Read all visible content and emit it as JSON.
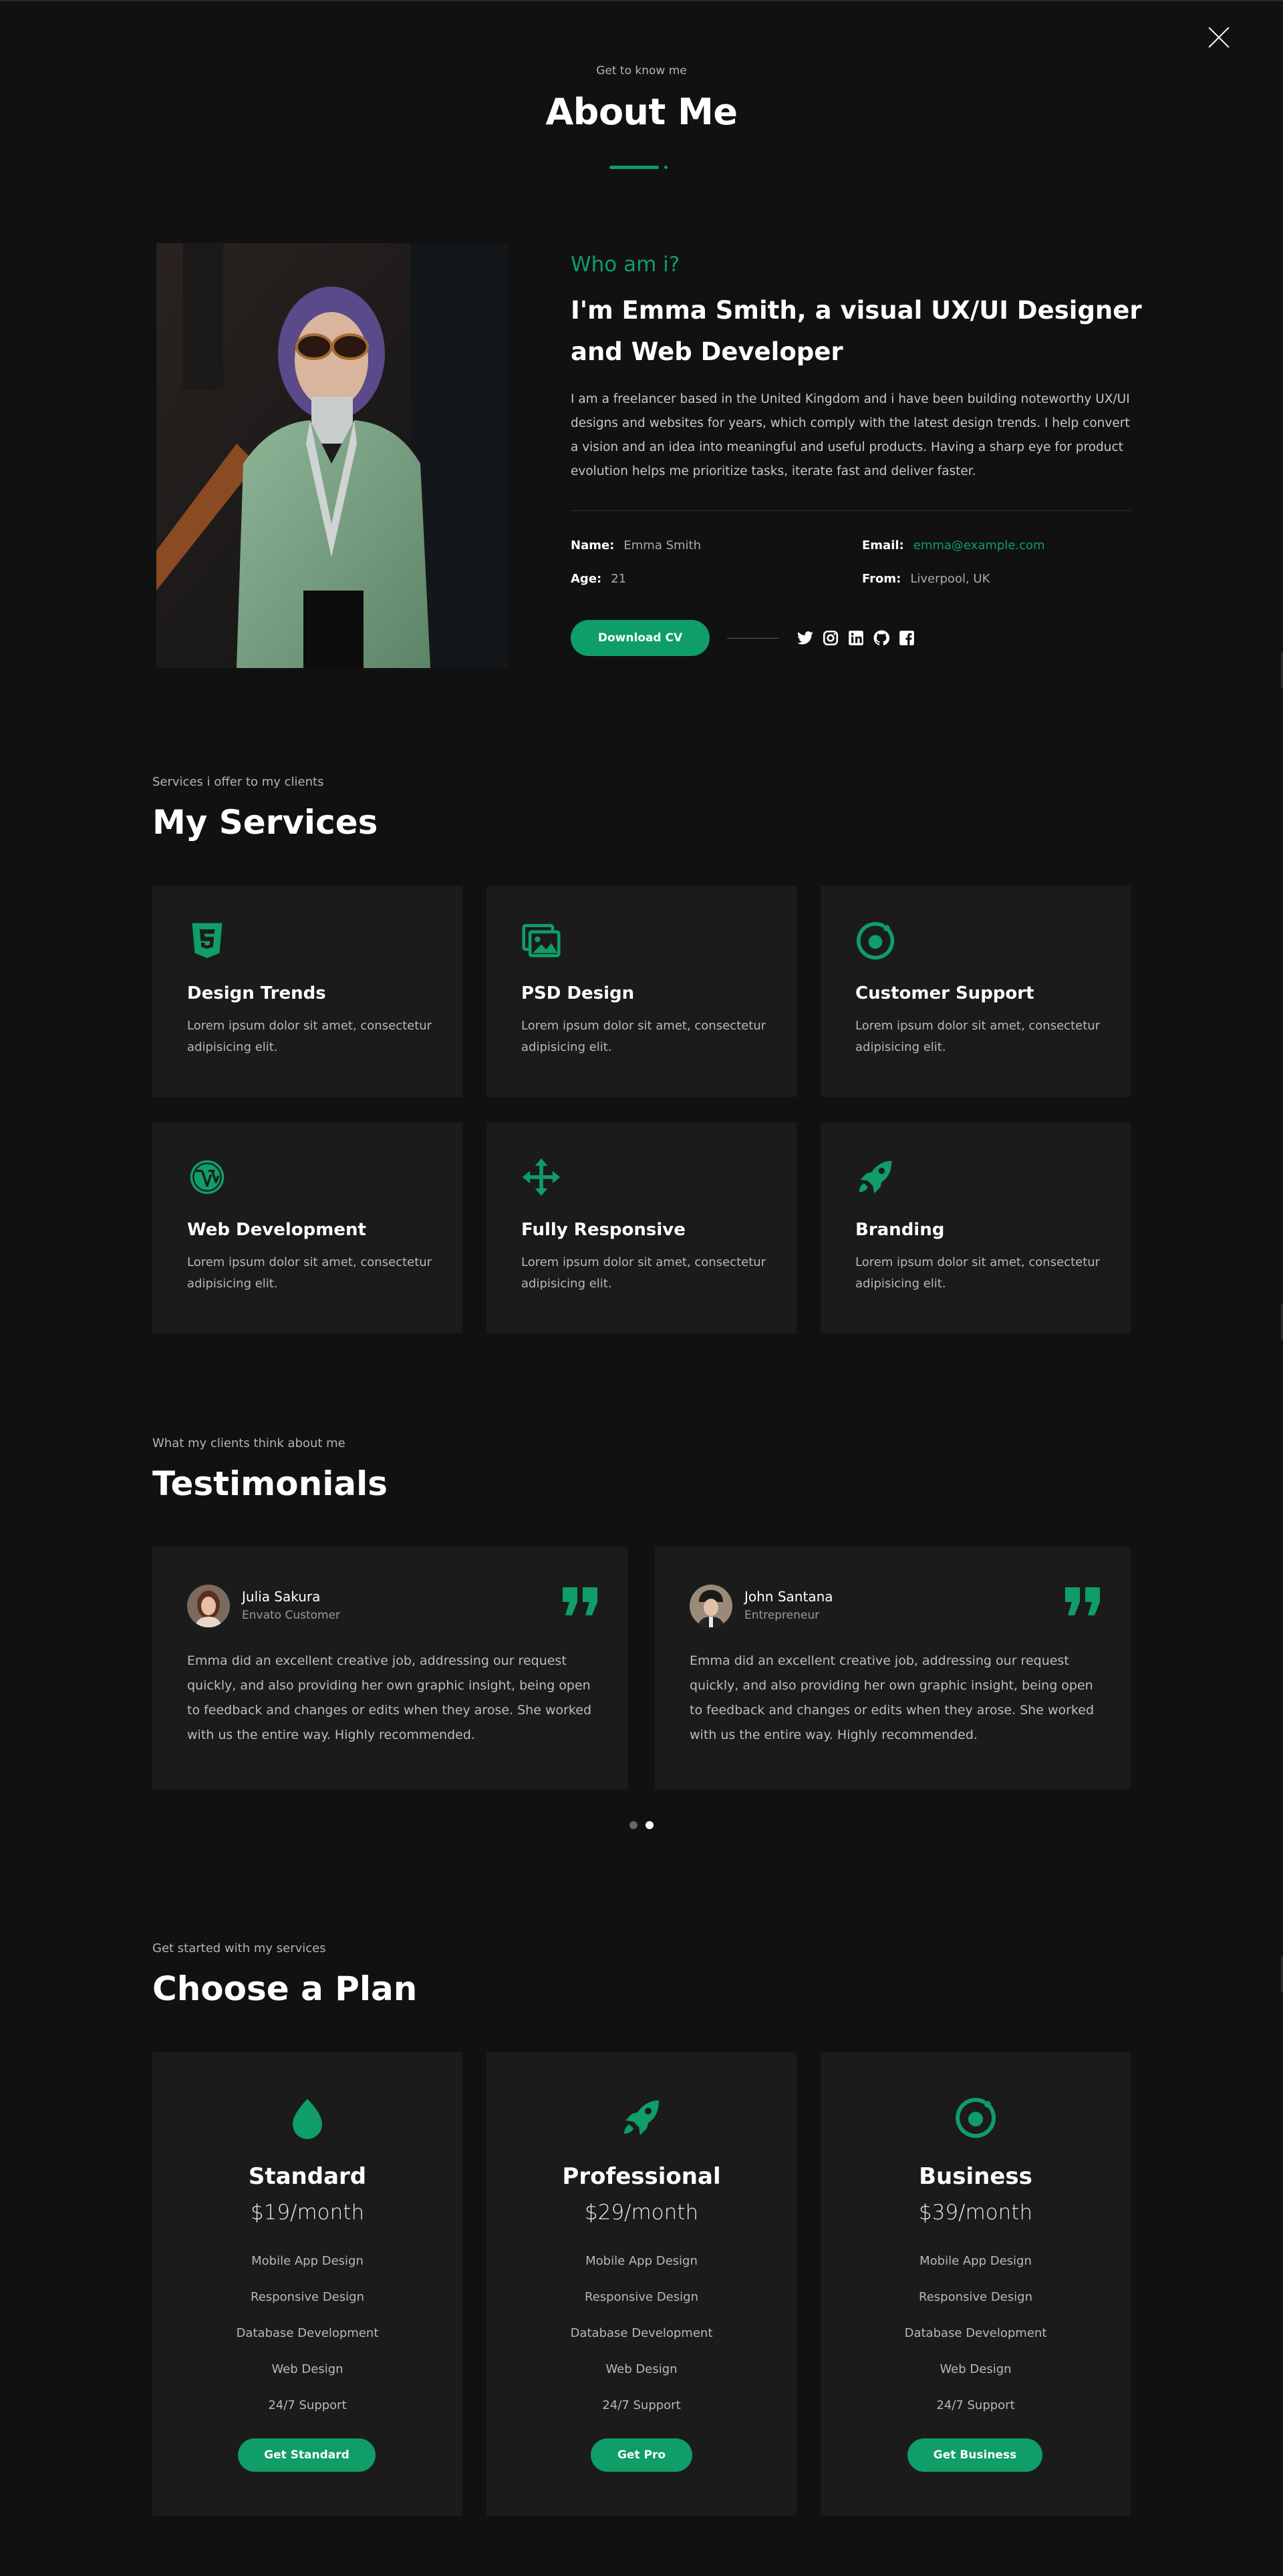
{
  "hero": {
    "subtitle": "Get to know me",
    "title": "About Me"
  },
  "about": {
    "who": "Who am i?",
    "headline": "I'm Emma Smith, a visual UX/UI Designer and Web Developer",
    "description": "I am a freelancer based in the United Kingdom and i have been building noteworthy UX/UI designs and websites for years, which comply with the latest design trends. I help convert a vision and an idea into meaningful and useful products. Having a sharp eye for product evolution helps me prioritize tasks, iterate fast and deliver faster.",
    "info": {
      "name_label": "Name:",
      "name_value": "Emma Smith",
      "email_label": "Email:",
      "email_value": "emma@example.com",
      "age_label": "Age:",
      "age_value": "21",
      "from_label": "From:",
      "from_value": "Liverpool, UK"
    },
    "download_label": "Download CV",
    "social": [
      "twitter-icon",
      "instagram-icon",
      "linkedin-icon",
      "github-icon",
      "facebook-icon"
    ]
  },
  "services": {
    "subtitle": "Services i offer to my clients",
    "title": "My Services",
    "items": [
      {
        "title": "Design Trends",
        "desc": "Lorem ipsum dolor sit amet, consectetur adipisicing elit.",
        "icon": "html5-icon"
      },
      {
        "title": "PSD Design",
        "desc": "Lorem ipsum dolor sit amet, consectetur adipisicing elit.",
        "icon": "images-icon"
      },
      {
        "title": "Customer Support",
        "desc": "Lorem ipsum dolor sit amet, consectetur adipisicing elit.",
        "icon": "target-icon"
      },
      {
        "title": "Web Development",
        "desc": "Lorem ipsum dolor sit amet, consectetur adipisicing elit.",
        "icon": "wordpress-icon"
      },
      {
        "title": "Fully Responsive",
        "desc": "Lorem ipsum dolor sit amet, consectetur adipisicing elit.",
        "icon": "arrows-icon"
      },
      {
        "title": "Branding",
        "desc": "Lorem ipsum dolor sit amet, consectetur adipisicing elit.",
        "icon": "rocket-icon"
      }
    ]
  },
  "testimonials": {
    "subtitle": "What my clients think about me",
    "title": "Testimonials",
    "items": [
      {
        "name": "Julia Sakura",
        "role": "Envato Customer",
        "text": "Emma did an excellent creative job, addressing our request quickly, and also providing her own graphic insight, being open to feedback and changes or edits when they arose. She worked with us the entire way. Highly recommended."
      },
      {
        "name": "John Santana",
        "role": "Entrepreneur",
        "text": "Emma did an excellent creative job, addressing our request quickly, and also providing her own graphic insight, being open to feedback and changes or edits when they arose. She worked with us the entire way. Highly recommended."
      }
    ],
    "active_page": 2
  },
  "plans": {
    "subtitle": "Get started with my services",
    "title": "Choose a Plan",
    "items": [
      {
        "name": "Standard",
        "price": "$19/month",
        "button": "Get Standard",
        "icon": "egg-icon",
        "features": [
          "Mobile App Design",
          "Responsive Design",
          "Database Development",
          "Web Design",
          "24/7 Support"
        ]
      },
      {
        "name": "Professional",
        "price": "$29/month",
        "button": "Get Pro",
        "icon": "rocket-icon",
        "features": [
          "Mobile App Design",
          "Responsive Design",
          "Database Development",
          "Web Design",
          "24/7 Support"
        ]
      },
      {
        "name": "Business",
        "price": "$39/month",
        "button": "Get Business",
        "icon": "target-icon",
        "features": [
          "Mobile App Design",
          "Responsive Design",
          "Database Development",
          "Web Design",
          "24/7 Support"
        ]
      }
    ]
  },
  "colors": {
    "accent": "#0f9d68",
    "background": "#111111",
    "card": "#1b1b1b"
  }
}
